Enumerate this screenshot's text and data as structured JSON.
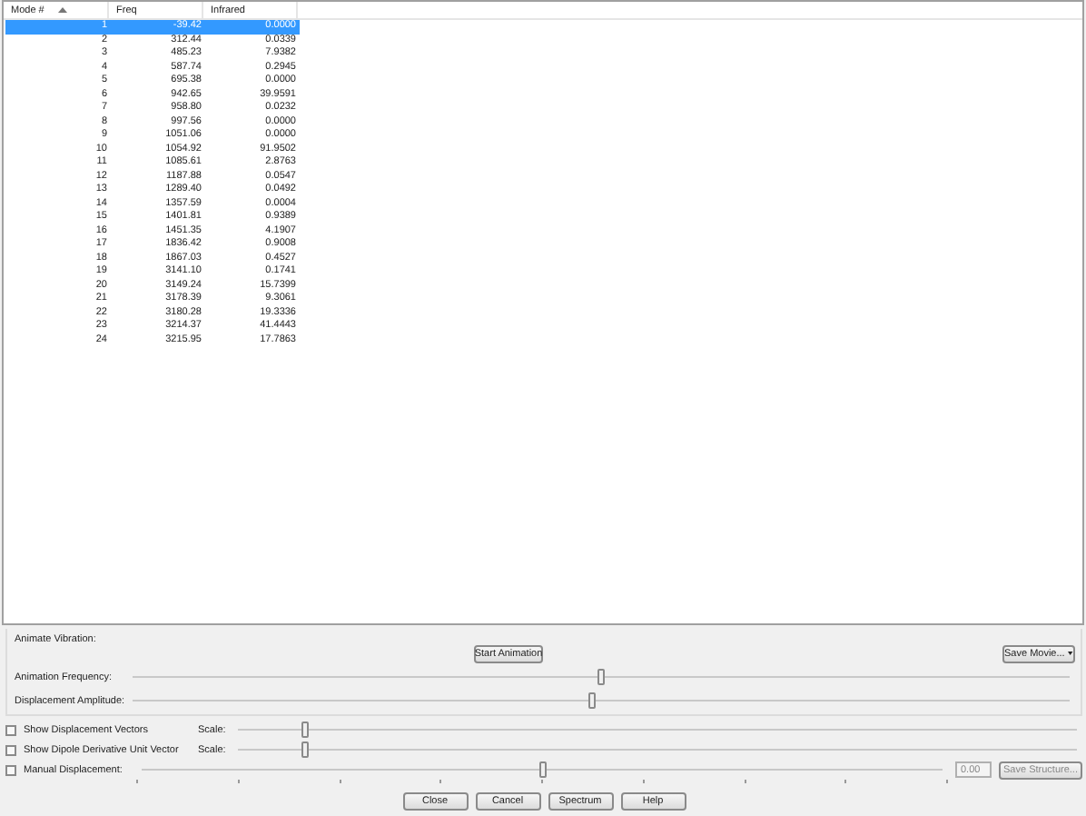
{
  "table": {
    "columns": [
      {
        "label": "Mode #",
        "sorted": true
      },
      {
        "label": "Freq",
        "sorted": false
      },
      {
        "label": "Infrared",
        "sorted": false
      }
    ],
    "rows": [
      {
        "cells": [
          "1",
          "-39.42",
          "0.0000"
        ],
        "selected": true
      },
      {
        "cells": [
          "2",
          "312.44",
          "0.0339"
        ],
        "selected": false
      },
      {
        "cells": [
          "3",
          "485.23",
          "7.9382"
        ],
        "selected": false
      },
      {
        "cells": [
          "4",
          "587.74",
          "0.2945"
        ],
        "selected": false
      },
      {
        "cells": [
          "5",
          "695.38",
          "0.0000"
        ],
        "selected": false
      },
      {
        "cells": [
          "6",
          "942.65",
          "39.9591"
        ],
        "selected": false
      },
      {
        "cells": [
          "7",
          "958.80",
          "0.0232"
        ],
        "selected": false
      },
      {
        "cells": [
          "8",
          "997.56",
          "0.0000"
        ],
        "selected": false
      },
      {
        "cells": [
          "9",
          "1051.06",
          "0.0000"
        ],
        "selected": false
      },
      {
        "cells": [
          "10",
          "1054.92",
          "91.9502"
        ],
        "selected": false
      },
      {
        "cells": [
          "11",
          "1085.61",
          "2.8763"
        ],
        "selected": false
      },
      {
        "cells": [
          "12",
          "1187.88",
          "0.0547"
        ],
        "selected": false
      },
      {
        "cells": [
          "13",
          "1289.40",
          "0.0492"
        ],
        "selected": false
      },
      {
        "cells": [
          "14",
          "1357.59",
          "0.0004"
        ],
        "selected": false
      },
      {
        "cells": [
          "15",
          "1401.81",
          "0.9389"
        ],
        "selected": false
      },
      {
        "cells": [
          "16",
          "1451.35",
          "4.1907"
        ],
        "selected": false
      },
      {
        "cells": [
          "17",
          "1836.42",
          "0.9008"
        ],
        "selected": false
      },
      {
        "cells": [
          "18",
          "1867.03",
          "0.4527"
        ],
        "selected": false
      },
      {
        "cells": [
          "19",
          "3141.10",
          "0.1741"
        ],
        "selected": false
      },
      {
        "cells": [
          "20",
          "3149.24",
          "15.7399"
        ],
        "selected": false
      },
      {
        "cells": [
          "21",
          "3178.39",
          "9.3061"
        ],
        "selected": false
      },
      {
        "cells": [
          "22",
          "3180.28",
          "19.3336"
        ],
        "selected": false
      },
      {
        "cells": [
          "23",
          "3214.37",
          "41.4443"
        ],
        "selected": false
      },
      {
        "cells": [
          "24",
          "3215.95",
          "17.7863"
        ],
        "selected": false
      }
    ]
  },
  "animate": {
    "title": "Animate Vibration:",
    "start_button": "Start Animation",
    "save_movie": "Save Movie...",
    "sliders": [
      {
        "label": "Animation Frequency:",
        "level": 0.5
      },
      {
        "label": "Displacement Amplitude:",
        "level": 0.49
      }
    ]
  },
  "options": [
    {
      "label": "Show Displacement Vectors",
      "checked": false,
      "scale_label": "Scale:",
      "level": 0.08
    },
    {
      "label": "Show Dipole Derivative Unit Vector",
      "checked": false,
      "scale_label": "Scale:",
      "level": 0.08
    }
  ],
  "manual": {
    "label": "Manual Displacement:",
    "checked": false,
    "level": 0.5,
    "value": "0.00",
    "save_button": "Save Structure..."
  },
  "buttons": [
    "Close",
    "Cancel",
    "Spectrum",
    "Help"
  ]
}
